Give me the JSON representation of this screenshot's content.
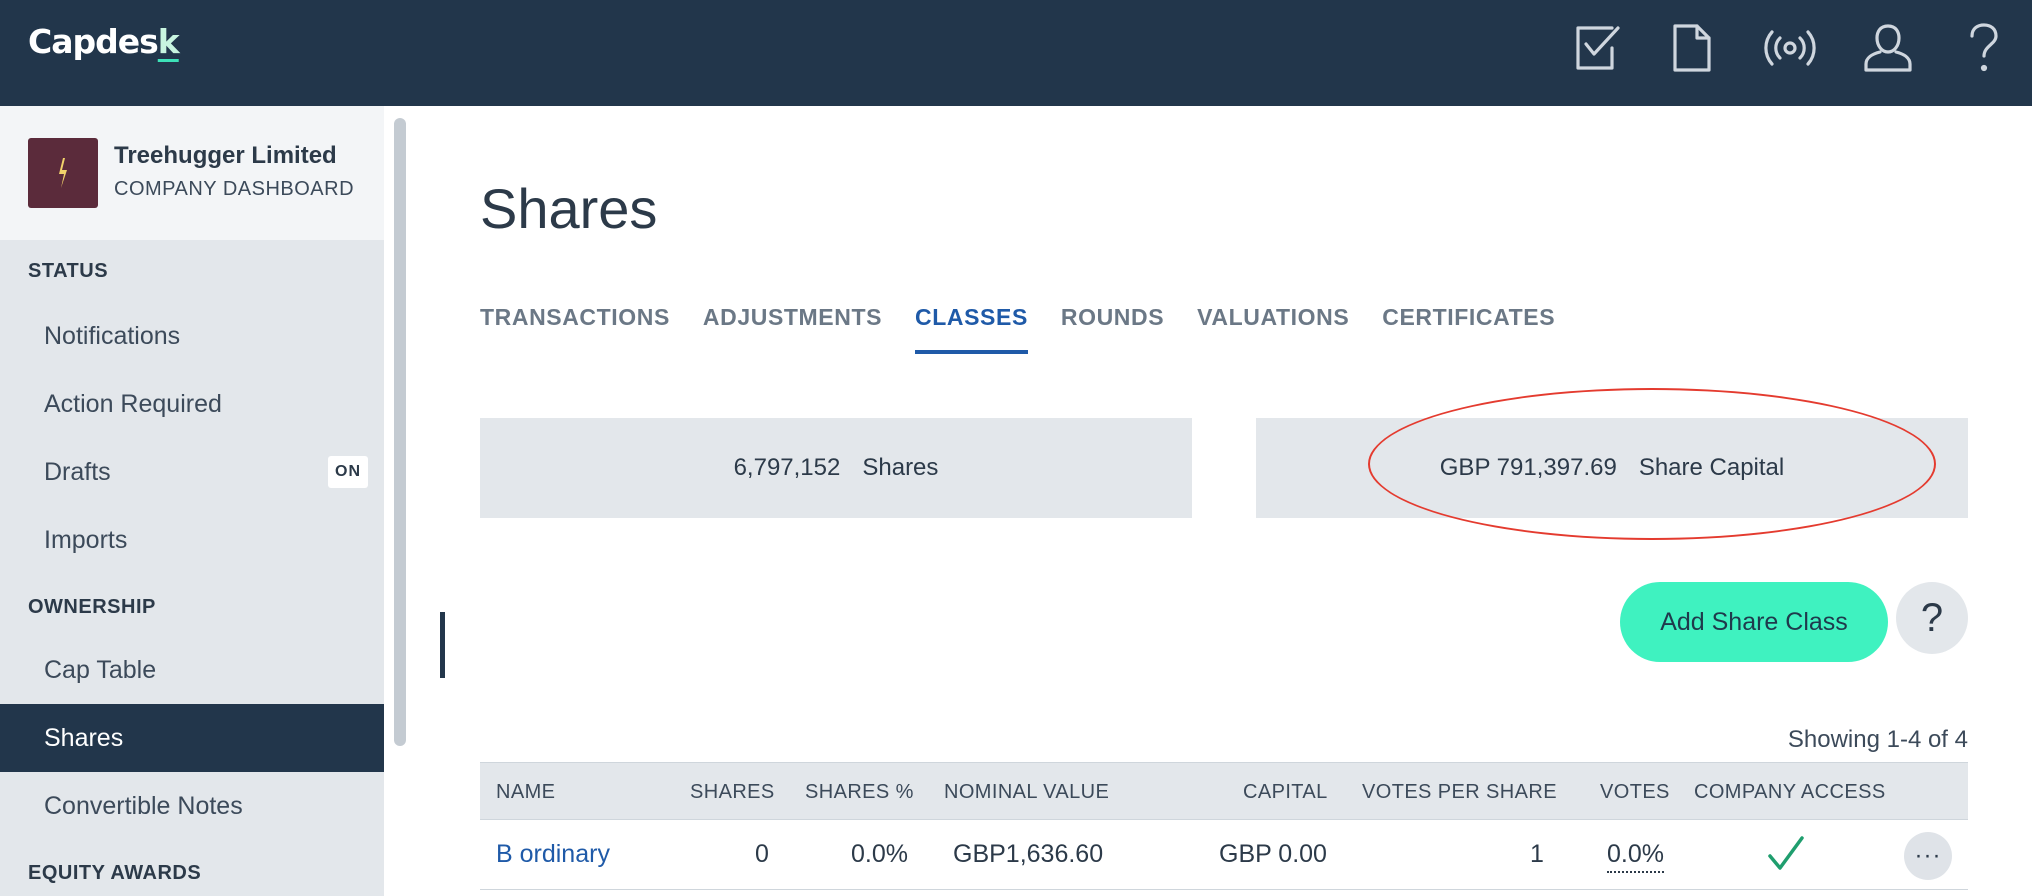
{
  "app": {
    "logo": "Capdesk"
  },
  "topbar": {
    "icons": [
      "tasks-icon",
      "document-icon",
      "broadcast-icon",
      "user-icon",
      "help-icon"
    ]
  },
  "sidebar": {
    "company_name": "Treehugger Limited",
    "company_sub": "COMPANY DASHBOARD",
    "sections": [
      {
        "title": "STATUS"
      },
      {
        "title": "OWNERSHIP"
      },
      {
        "title": "EQUITY AWARDS"
      }
    ],
    "items": [
      {
        "label": "Notifications"
      },
      {
        "label": "Action Required"
      },
      {
        "label": "Drafts",
        "badge": "ON"
      },
      {
        "label": "Imports"
      },
      {
        "label": "Cap Table"
      },
      {
        "label": "Shares",
        "active": true
      },
      {
        "label": "Convertible Notes"
      }
    ]
  },
  "main": {
    "title": "Shares",
    "tabs": [
      {
        "label": "TRANSACTIONS"
      },
      {
        "label": "ADJUSTMENTS"
      },
      {
        "label": "CLASSES",
        "active": true
      },
      {
        "label": "ROUNDS"
      },
      {
        "label": "VALUATIONS"
      },
      {
        "label": "CERTIFICATES"
      }
    ],
    "stats": {
      "shares_value": "6,797,152",
      "shares_label": "Shares",
      "capital_value": "GBP 791,397.69",
      "capital_label": "Share Capital"
    },
    "add_button": "Add Share Class",
    "help_button": "?",
    "showing": "Showing 1-4 of 4",
    "table": {
      "headers": [
        "NAME",
        "SHARES",
        "SHARES %",
        "NOMINAL VALUE",
        "CAPITAL",
        "VOTES PER SHARE",
        "VOTES",
        "COMPANY ACCESS"
      ],
      "rows": [
        {
          "name": "B ordinary",
          "shares": "0",
          "shares_pct": "0.0%",
          "nominal_value": "GBP1,636.60",
          "capital": "GBP 0.00",
          "votes_per_share": "1",
          "votes": "0.0%",
          "company_access": true,
          "more": "···"
        }
      ]
    }
  },
  "colors": {
    "topbar": "#22364b",
    "accent_button": "#3ff2c0",
    "active_tab": "#1f5aa8",
    "annotation_ellipse": "#e43b2f",
    "check": "#1f9e6e"
  }
}
